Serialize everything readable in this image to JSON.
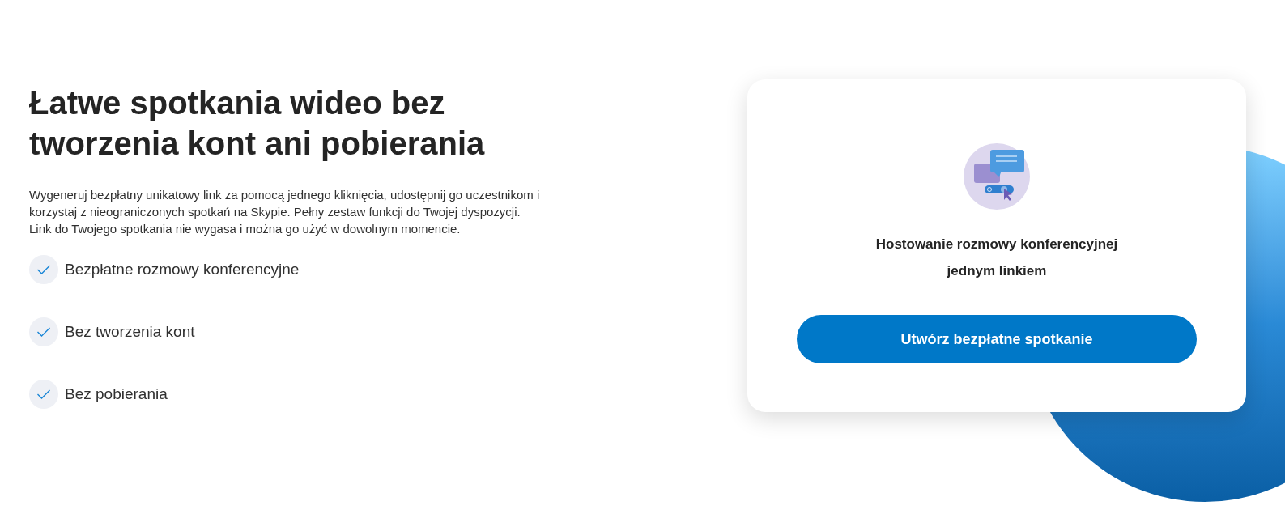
{
  "heading": "Łatwe spotkania wideo bez tworzenia kont ani pobierania",
  "description": [
    "Wygeneruj bezpłatny unikatowy link za pomocą jednego kliknięcia, udostępnij go uczestnikom i korzystaj z nieograniczonych spotkań na Skypie. Pełny zestaw funkcji do Twojej dyspozycji.",
    "Link do Twojego spotkania nie wygasa i można go użyć w dowolnym momencie."
  ],
  "features": [
    "Bezpłatne rozmowy konferencyjne",
    "Bez tworzenia kont",
    "Bez pobierania"
  ],
  "card": {
    "title": "Hostowanie rozmowy konferencyjnej jednym linkiem",
    "button": "Utwórz bezpłatne spotkanie"
  }
}
